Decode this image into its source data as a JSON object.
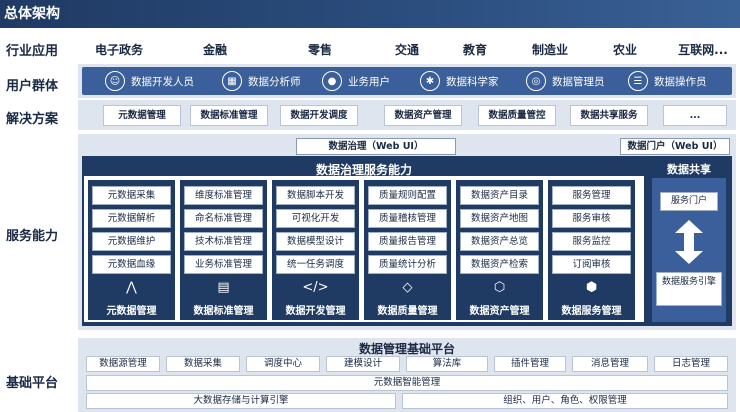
{
  "title": "总体架构",
  "rows": {
    "industry": "行业应用",
    "users": "用户群体",
    "solutions": "解决方案",
    "services": "服务能力",
    "base": "基础平台"
  },
  "industries": [
    "电子政务",
    "金融",
    "零售",
    "交通",
    "教育",
    "制造业",
    "农业",
    "互联网..."
  ],
  "users": [
    {
      "label": "数据开发人员",
      "icon": "developer-icon"
    },
    {
      "label": "数据分析师",
      "icon": "analyst-icon"
    },
    {
      "label": "业务用户",
      "icon": "user-icon"
    },
    {
      "label": "数据科学家",
      "icon": "scientist-icon"
    },
    {
      "label": "数据管理员",
      "icon": "admin-icon"
    },
    {
      "label": "数据操作员",
      "icon": "operator-icon"
    }
  ],
  "solutions": [
    "元数据管理",
    "数据标准管理",
    "数据开发调度",
    "数据资产管理",
    "数据质量管控",
    "数据共享服务",
    "..."
  ],
  "services": {
    "webui_left": "数据治理（Web UI）",
    "webui_right": "数据门户（Web UI）",
    "governance_title": "数据治理服务能力",
    "share_title": "数据共享",
    "share_portal": "服务门户",
    "share_engine": "数据服务引擎",
    "columns": [
      {
        "title": "元数据管理",
        "icon": "lineage-icon",
        "glyph": "⋀",
        "items": [
          "元数据采集",
          "元数据解析",
          "元数据维护",
          "元数据血缘"
        ]
      },
      {
        "title": "数据标准管理",
        "icon": "standard-icon",
        "glyph": "▤",
        "items": [
          "维度标准管理",
          "命名标准管理",
          "技术标准管理",
          "业务标准管理"
        ]
      },
      {
        "title": "数据开发管理",
        "icon": "code-icon",
        "glyph": "</>",
        "items": [
          "数据脚本开发",
          "可视化开发",
          "数据模型设计",
          "统一任务调度"
        ]
      },
      {
        "title": "数据质量管理",
        "icon": "diamond-icon",
        "glyph": "◇",
        "items": [
          "质量规则配置",
          "质量稽核管理",
          "质量报告管理",
          "质量统计分析"
        ]
      },
      {
        "title": "数据资产管理",
        "icon": "asset-icon",
        "glyph": "⬡",
        "items": [
          "数据资产目录",
          "数据资产地图",
          "数据资产总览",
          "数据资产检索"
        ]
      },
      {
        "title": "数据服务管理",
        "icon": "service-icon",
        "glyph": "⬢",
        "items": [
          "服务管理",
          "服务审核",
          "服务监控",
          "订阅审核"
        ]
      }
    ]
  },
  "base": {
    "title": "数据管理基础平台",
    "modules": [
      "数据源管理",
      "数据采集",
      "调度中心",
      "建模设计",
      "算法库",
      "插件管理",
      "消息管理",
      "日志管理"
    ],
    "metadata_bar": "元数据智能管理",
    "storage": "大数据存储与计算引擎",
    "org": "组织、用户、角色、权限管理"
  }
}
